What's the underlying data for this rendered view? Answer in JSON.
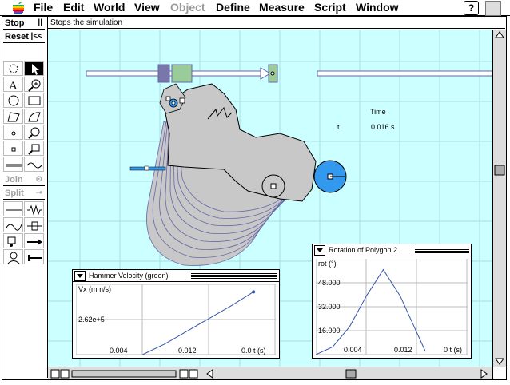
{
  "menubar": {
    "items": [
      "File",
      "Edit",
      "World",
      "View",
      "Object",
      "Define",
      "Measure",
      "Script",
      "Window"
    ],
    "disabled": [
      "Object"
    ],
    "help_label": "?"
  },
  "toolbar": {
    "stop_label": "Stop",
    "stop_symbol": "||",
    "reset_label": "Reset",
    "reset_symbol": "|<<",
    "join_label": "Join",
    "join_symbol": "⊙",
    "split_label": "Split",
    "split_symbol": "⊸",
    "tools": [
      "rotate-tool",
      "arrow-tool",
      "text-tool",
      "zoom-tool",
      "circle-tool",
      "rectangle-tool",
      "polygon-tool",
      "curved-polygon-tool",
      "point-tool",
      "point-zoom-tool",
      "square-point-tool",
      "square-zoom-tool",
      "rod-tool",
      "rope-tool",
      "spring-tool",
      "damper-tool",
      "actuator-tool",
      "separator-tool",
      "motor-tool",
      "force-tool",
      "person-tool",
      "anchor-tool"
    ]
  },
  "status_text": "Stops the simulation",
  "time_meter": {
    "title": "Time",
    "label": "t",
    "value": "0.016 s"
  },
  "graph_velocity": {
    "title": "Hammer Velocity (green)",
    "y_label": "Vx (mm/s)",
    "y_tick": "2.62e+5",
    "x_ticks": [
      "0.004",
      "0.012",
      "0.0 t (s)"
    ]
  },
  "graph_rotation": {
    "title": "Rotation of Polygon 2",
    "y_label": "rot (°)",
    "y_ticks": [
      "48.000",
      "32.000",
      "16.000"
    ],
    "x_ticks": [
      "0.004",
      "0.012",
      "0 t (s)"
    ]
  },
  "chart_data": [
    {
      "type": "line",
      "title": "Hammer Velocity (green)",
      "ylabel": "Vx (mm/s)",
      "xlabel": "t (s)",
      "x": [
        0.006,
        0.008,
        0.01,
        0.012,
        0.014,
        0.016
      ],
      "y": [
        0,
        50000,
        110000,
        170000,
        230000,
        295000
      ],
      "ylim": [
        0,
        330000
      ],
      "grid": true
    },
    {
      "type": "line",
      "title": "Rotation of Polygon 2",
      "ylabel": "rot (°)",
      "xlabel": "t (s)",
      "x": [
        0.0,
        0.002,
        0.004,
        0.006,
        0.008,
        0.01,
        0.012,
        0.013
      ],
      "y": [
        0,
        5,
        18,
        38,
        55,
        38,
        14,
        2
      ],
      "ylim": [
        0,
        62
      ],
      "grid": true
    }
  ],
  "colors": {
    "canvas": "#ccffff",
    "body": "#c8c8c8",
    "outline": "#6666aa",
    "blue": "#3399ee",
    "green": "#99cc99",
    "purple": "#6666aa"
  }
}
